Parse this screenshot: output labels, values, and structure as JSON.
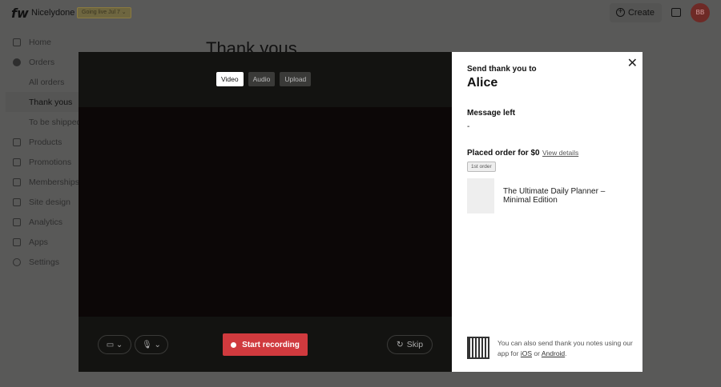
{
  "header": {
    "logo": "fw",
    "brand": "Nicelydone",
    "badge": "Going live Jul 7 ⌄",
    "create": "Create",
    "avatar": "BB"
  },
  "sidebar": {
    "items": [
      {
        "label": "Home"
      },
      {
        "label": "Orders"
      },
      {
        "label": "All orders"
      },
      {
        "label": "Thank yous"
      },
      {
        "label": "To be shipped"
      },
      {
        "label": "Products"
      },
      {
        "label": "Promotions"
      },
      {
        "label": "Memberships"
      },
      {
        "label": "Site design"
      },
      {
        "label": "Analytics"
      },
      {
        "label": "Apps"
      },
      {
        "label": "Settings"
      }
    ]
  },
  "page": {
    "title": "Thank yous"
  },
  "recorder": {
    "tabs": [
      "Video",
      "Audio",
      "Upload"
    ],
    "start": "Start recording",
    "skip": "Skip",
    "camera": "▭ ⌄",
    "mic": "🎙 ⌄"
  },
  "panel": {
    "send_label": "Send thank you to",
    "name": "Alice",
    "message_label": "Message left",
    "message": "-",
    "order_label": "Placed order for $0",
    "view_details": "View details",
    "order_badge": "1st order",
    "product": "The Ultimate Daily Planner – Minimal Edition",
    "app_text": "You can also send thank you notes using our app for",
    "ios": "iOS",
    "or": "or",
    "android": "Android",
    "close": "✕"
  }
}
